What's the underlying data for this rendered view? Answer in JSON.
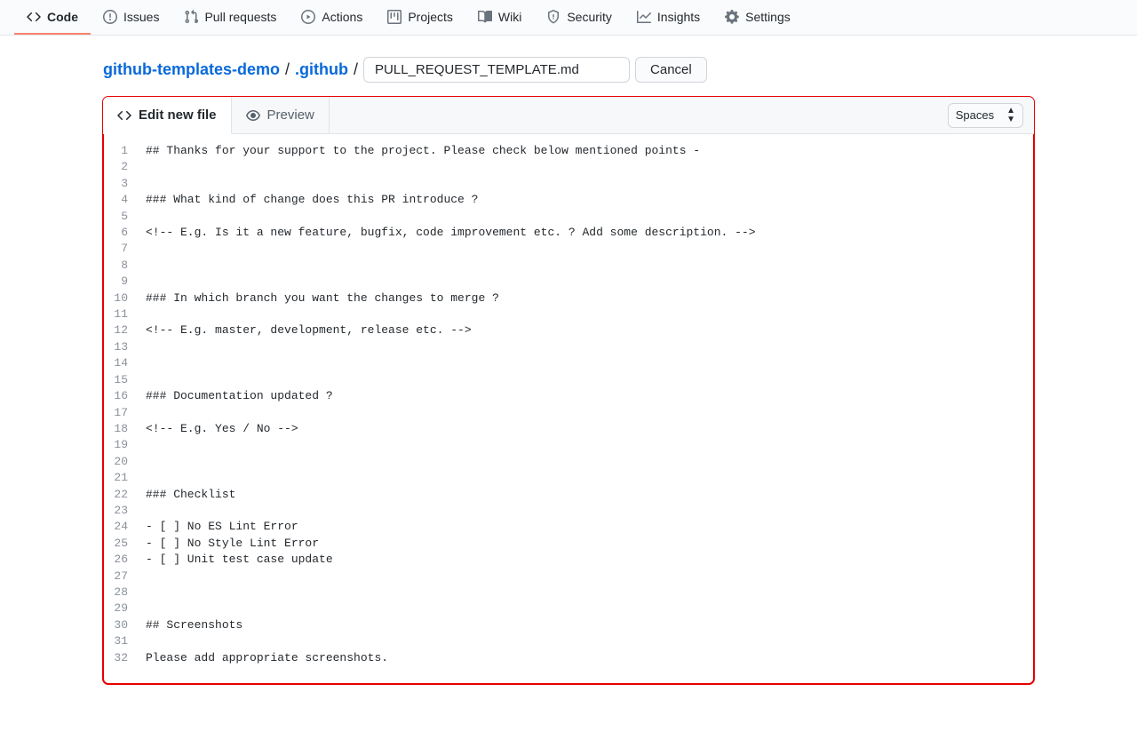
{
  "nav": [
    {
      "label": "Code",
      "icon": "code",
      "active": true
    },
    {
      "label": "Issues",
      "icon": "issue",
      "active": false
    },
    {
      "label": "Pull requests",
      "icon": "pr",
      "active": false
    },
    {
      "label": "Actions",
      "icon": "actions",
      "active": false
    },
    {
      "label": "Projects",
      "icon": "projects",
      "active": false
    },
    {
      "label": "Wiki",
      "icon": "wiki",
      "active": false
    },
    {
      "label": "Security",
      "icon": "security",
      "active": false
    },
    {
      "label": "Insights",
      "icon": "insights",
      "active": false
    },
    {
      "label": "Settings",
      "icon": "settings",
      "active": false
    }
  ],
  "breadcrumb": {
    "repo": "github-templates-demo",
    "folder": ".github",
    "filename": "PULL_REQUEST_TEMPLATE.md"
  },
  "buttons": {
    "cancel": "Cancel"
  },
  "tabs": {
    "edit": "Edit new file",
    "preview": "Preview"
  },
  "indent_mode": "Spaces",
  "code_lines": [
    "## Thanks for your support to the project. Please check below mentioned points -",
    "",
    "",
    "### What kind of change does this PR introduce ?",
    "",
    "<!-- E.g. Is it a new feature, bugfix, code improvement etc. ? Add some description. -->",
    "",
    "",
    "",
    "### In which branch you want the changes to merge ?",
    "",
    "<!-- E.g. master, development, release etc. -->",
    "",
    "",
    "",
    "### Documentation updated ?",
    "",
    "<!-- E.g. Yes / No -->",
    "",
    "",
    "",
    "### Checklist",
    "",
    "- [ ] No ES Lint Error",
    "- [ ] No Style Lint Error",
    "- [ ] Unit test case update",
    "",
    "",
    "",
    "## Screenshots",
    "",
    "Please add appropriate screenshots."
  ]
}
